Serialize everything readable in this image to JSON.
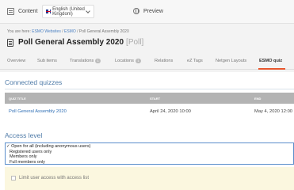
{
  "topbar": {
    "content_label": "Content",
    "content_icon": "content-list-icon",
    "language_value": "English (United Kingdom)",
    "flag_icon": "uk-flag-icon",
    "preview_label": "Preview",
    "preview_icon": "globe-icon"
  },
  "breadcrumb": {
    "prefix": "You are here:",
    "items": [
      "ESMO Websites",
      "ESMO",
      "Poll General Assembly 2020"
    ]
  },
  "page": {
    "title": "Poll General Assembly 2020",
    "content_type": "[Poll]",
    "title_icon": "document-icon"
  },
  "tabs": [
    {
      "label": "Overview"
    },
    {
      "label": "Sub items"
    },
    {
      "label": "Translations",
      "count": "1"
    },
    {
      "label": "Locations",
      "count": "1"
    },
    {
      "label": "Relations"
    },
    {
      "label": "eZ Tags"
    },
    {
      "label": "Netgen Layouts"
    },
    {
      "label": "ESMO quiz",
      "active": true
    }
  ],
  "quizzes": {
    "heading": "Connected quizzes",
    "columns": [
      "QUIZ TITLE",
      "START",
      "END"
    ],
    "rows": [
      {
        "title": "Poll General Assembly 2020",
        "start": "April 24, 2020 10:00",
        "end": "May 4, 2020 12:00"
      }
    ]
  },
  "access": {
    "heading": "Access level",
    "options": [
      {
        "label": "Open for all (including anonymous users)",
        "selected": true
      },
      {
        "label": "Registered users only"
      },
      {
        "label": "Members only"
      },
      {
        "label": "Full members only"
      }
    ],
    "limit_label": "Limit user access with access list",
    "limit_checked": false
  },
  "colors": {
    "accent": "#e8572e",
    "link": "#2f6fb5",
    "heading": "#4f7ba8",
    "notice_bg": "#fbf7df"
  }
}
